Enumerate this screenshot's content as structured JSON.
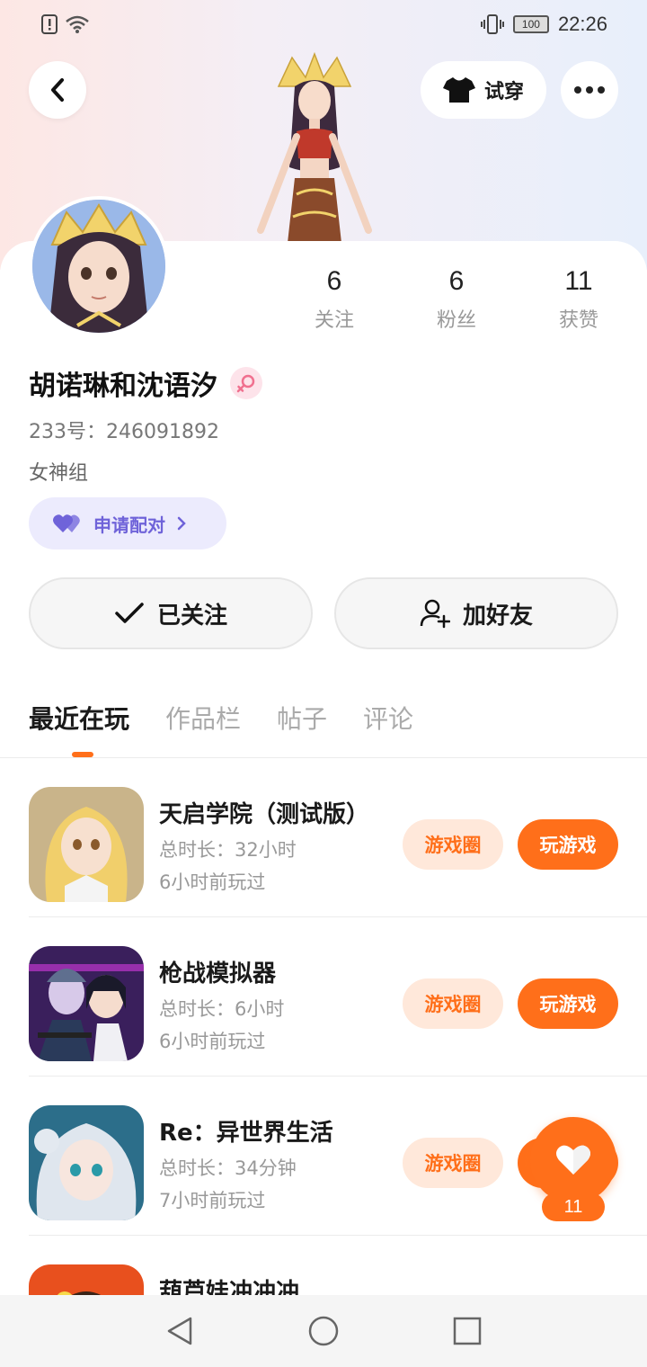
{
  "status_bar": {
    "time": "22:26",
    "battery": "100"
  },
  "header": {
    "tryon_label": "试穿"
  },
  "profile": {
    "name": "胡诺琳和沈语汐",
    "uid": "233号：246091892",
    "group": "女神组",
    "pair_label": "申请配对",
    "stats": [
      {
        "value": "6",
        "label": "关注"
      },
      {
        "value": "6",
        "label": "粉丝"
      },
      {
        "value": "11",
        "label": "获赞"
      }
    ],
    "follow_label": "已关注",
    "add_friend_label": "加好友"
  },
  "tabs": [
    {
      "label": "最近在玩",
      "active": true
    },
    {
      "label": "作品栏",
      "active": false
    },
    {
      "label": "帖子",
      "active": false
    },
    {
      "label": "评论",
      "active": false
    }
  ],
  "games": [
    {
      "title": "天启学院（测试版）",
      "duration": "总时长：32小时",
      "last_played": "6小时前玩过",
      "circle_label": "游戏圈",
      "play_label": "玩游戏"
    },
    {
      "title": "枪战模拟器",
      "duration": "总时长：6小时",
      "last_played": "6小时前玩过",
      "circle_label": "游戏圈",
      "play_label": "玩游戏"
    },
    {
      "title": "Re：异世界生活",
      "duration": "总时长：34分钟",
      "last_played": "7小时前玩过",
      "circle_label": "游戏圈",
      "play_label": "玩游戏"
    },
    {
      "title": "葫芦娃冲冲冲",
      "duration": "",
      "last_played": "",
      "circle_label": "",
      "play_label": ""
    }
  ],
  "like": {
    "count": "11"
  },
  "colors": {
    "accent": "#ff6f1a",
    "pair": "#6f63d9"
  }
}
